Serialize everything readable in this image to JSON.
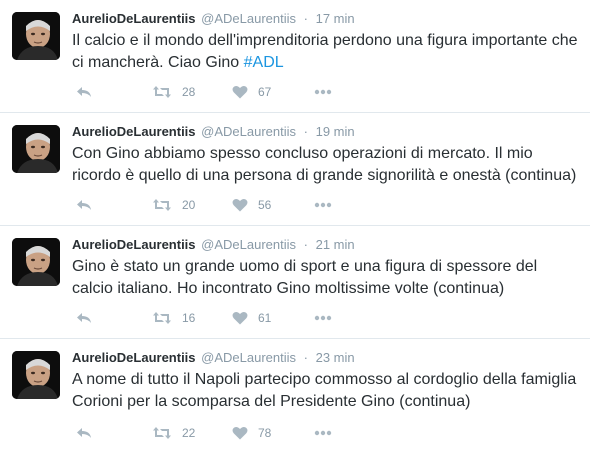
{
  "colors": {
    "link": "#1b95e0",
    "text": "#292f33",
    "muted": "#8899a6",
    "icon": "#aab8c2",
    "divider": "#e1e8ed"
  },
  "tweets": [
    {
      "name": "AurelioDeLaurentiis",
      "handle": "@ADeLaurentiis",
      "separator": "·",
      "time": "17 min",
      "text": "Il calcio e il mondo dell'imprenditoria perdono una figura importante che ci mancherà. Ciao Gino ",
      "hashtag": "#ADL",
      "retweets": "28",
      "likes": "67",
      "icons": [
        "reply-icon",
        "retweet-icon",
        "heart-icon",
        "more-icon"
      ]
    },
    {
      "name": "AurelioDeLaurentiis",
      "handle": "@ADeLaurentiis",
      "separator": "·",
      "time": "19 min",
      "text": "Con Gino abbiamo spesso concluso operazioni di mercato. Il mio ricordo è quello di una persona di grande signorilità e onestà (continua)",
      "hashtag": "",
      "retweets": "20",
      "likes": "56",
      "icons": [
        "reply-icon",
        "retweet-icon",
        "heart-icon",
        "more-icon"
      ]
    },
    {
      "name": "AurelioDeLaurentiis",
      "handle": "@ADeLaurentiis",
      "separator": "·",
      "time": "21 min",
      "text": "Gino è stato un grande uomo di sport e una figura di spessore del calcio italiano.  Ho incontrato Gino moltissime volte (continua)",
      "hashtag": "",
      "retweets": "16",
      "likes": "61",
      "icons": [
        "reply-icon",
        "retweet-icon",
        "heart-icon",
        "more-icon"
      ]
    },
    {
      "name": "AurelioDeLaurentiis",
      "handle": "@ADeLaurentiis",
      "separator": "·",
      "time": "23 min",
      "text": "A nome di tutto il Napoli partecipo commosso al cordoglio della famiglia Corioni per la scomparsa del Presidente Gino (continua)",
      "hashtag": "",
      "retweets": "22",
      "likes": "78",
      "icons": [
        "reply-icon",
        "retweet-icon",
        "heart-icon",
        "more-icon"
      ]
    }
  ]
}
